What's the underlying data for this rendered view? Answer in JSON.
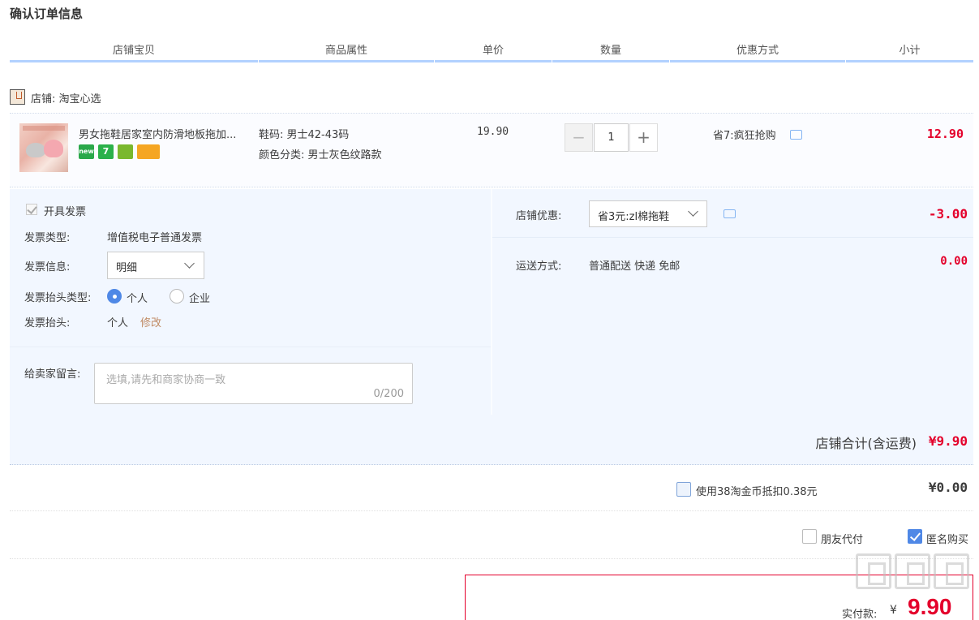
{
  "page": {
    "title": "确认订单信息"
  },
  "table_header": {
    "columns": [
      "店铺宝贝",
      "商品属性",
      "单价",
      "数量",
      "优惠方式",
      "小计"
    ]
  },
  "store": {
    "label": "店铺: 淘宝心选",
    "icon": "store-icon"
  },
  "item": {
    "title": "男女拖鞋居家室内防滑地板拖加...",
    "badges": [
      "new-badge",
      "7-day-return-badge",
      "certified-badge",
      "card-badge"
    ],
    "badge_text": {
      "new": "new",
      "seven": "7"
    },
    "attr_size": "鞋码: 男士42-43码",
    "attr_color": "颜色分类: 男士灰色纹路款",
    "unit_price": "19.90",
    "quantity": "1",
    "qty_minus": "−",
    "qty_plus": "+",
    "promo": "省7:疯狂抢购",
    "subtotal": "12.90"
  },
  "invoice": {
    "checkbox_label": "开具发票",
    "type_label": "发票类型:",
    "type_value": "增值税电子普通发票",
    "info_label": "发票信息:",
    "info_value": "明细",
    "title_type_label": "发票抬头类型:",
    "title_type_options": [
      "个人",
      "企业"
    ],
    "title_type_selected": "个人",
    "title_label": "发票抬头:",
    "title_value": "个人",
    "modify_link": "修改"
  },
  "memo": {
    "label": "给卖家留言:",
    "placeholder": "选填,请先和商家协商一致",
    "count": "0/200"
  },
  "coupon": {
    "label": "店铺优惠:",
    "value": "省3元:zl棉拖鞋",
    "amount": "-3.00"
  },
  "shipping": {
    "label": "运送方式:",
    "value": "普通配送 快递 免邮",
    "amount": "0.00"
  },
  "store_total": {
    "label": "店铺合计(含运费)",
    "value": "¥9.90"
  },
  "coins": {
    "label": "使用38淘金币抵扣0.38元",
    "value": "¥0.00",
    "checked": false
  },
  "pay_options": {
    "friend_pay": {
      "label": "朋友代付",
      "checked": false
    },
    "anonymous": {
      "label": "匿名购买",
      "checked": true
    }
  },
  "total": {
    "label": "实付款:",
    "currency": "¥",
    "value": "9.90"
  },
  "colors": {
    "accent_blue": "#b2d1ff",
    "price_red": "#e4002b",
    "panel_bg": "#f2f7ff"
  }
}
